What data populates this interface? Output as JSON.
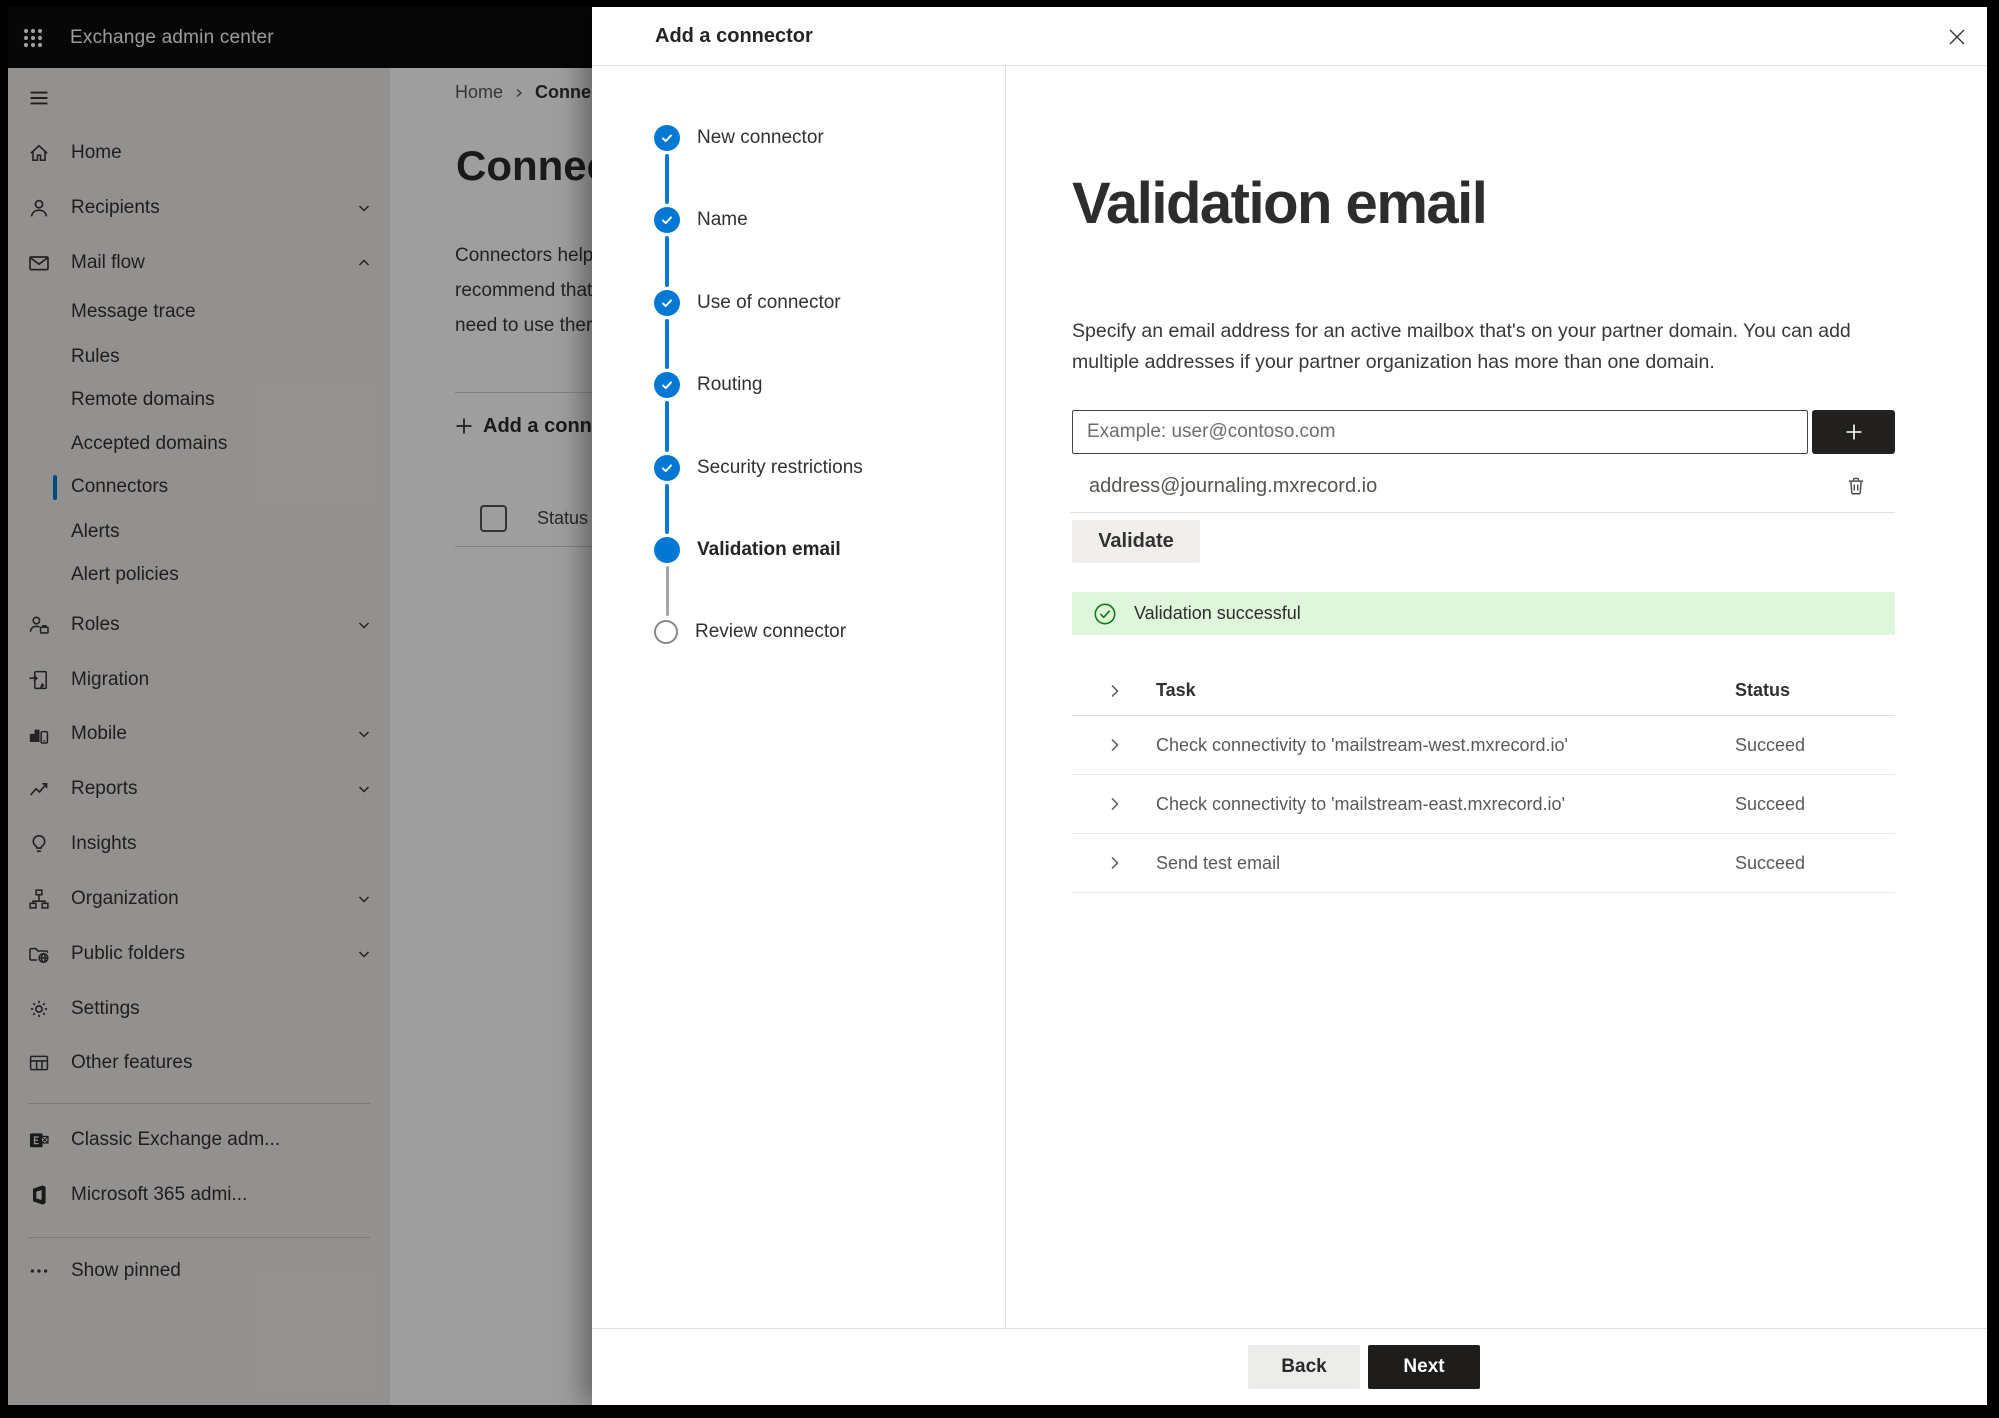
{
  "topbar": {
    "app_title": "Exchange admin center"
  },
  "sidebar": {
    "items": [
      {
        "label": "Home",
        "icon": "home"
      },
      {
        "label": "Recipients",
        "icon": "person",
        "expandable": true
      },
      {
        "label": "Mail flow",
        "icon": "mail",
        "expandable": true,
        "expanded": true,
        "children": [
          "Message trace",
          "Rules",
          "Remote domains",
          "Accepted domains",
          "Connectors",
          "Alerts",
          "Alert policies"
        ],
        "selected_child": "Connectors"
      },
      {
        "label": "Roles",
        "icon": "roles",
        "expandable": true
      },
      {
        "label": "Migration",
        "icon": "migration"
      },
      {
        "label": "Mobile",
        "icon": "mobile",
        "expandable": true
      },
      {
        "label": "Reports",
        "icon": "reports",
        "expandable": true
      },
      {
        "label": "Insights",
        "icon": "insights"
      },
      {
        "label": "Organization",
        "icon": "organization",
        "expandable": true
      },
      {
        "label": "Public folders",
        "icon": "public-folders",
        "expandable": true
      },
      {
        "label": "Settings",
        "icon": "settings"
      },
      {
        "label": "Other features",
        "icon": "other-features"
      }
    ],
    "footer_items": [
      {
        "label": "Classic Exchange adm..."
      },
      {
        "label": "Microsoft 365 admi..."
      },
      {
        "label": "Show pinned"
      }
    ]
  },
  "background_page": {
    "breadcrumb": {
      "home": "Home",
      "current": "Conne"
    },
    "title": "Connec",
    "paragraph_lines": [
      "Connectors help",
      "recommend that",
      "need to use ther"
    ],
    "add_button": "Add a conn",
    "column_header": "Status"
  },
  "dialog": {
    "title": "Add a connector",
    "steps": [
      {
        "label": "New connector",
        "state": "done"
      },
      {
        "label": "Name",
        "state": "done"
      },
      {
        "label": "Use of connector",
        "state": "done"
      },
      {
        "label": "Routing",
        "state": "done"
      },
      {
        "label": "Security restrictions",
        "state": "done"
      },
      {
        "label": "Validation email",
        "state": "current"
      },
      {
        "label": "Review connector",
        "state": "todo"
      }
    ],
    "content": {
      "heading": "Validation email",
      "description": "Specify an email address for an active mailbox that's on your partner domain. You can add multiple addresses if your partner organization has more than one domain.",
      "email_placeholder": "Example: user@contoso.com",
      "added_address": "address@journaling.mxrecord.io",
      "validate_button": "Validate",
      "banner_text": "Validation successful",
      "table": {
        "columns": {
          "task": "Task",
          "status": "Status"
        },
        "rows": [
          {
            "task": "Check connectivity to 'mailstream-west.mxrecord.io'",
            "status": "Succeed"
          },
          {
            "task": "Check connectivity to 'mailstream-east.mxrecord.io'",
            "status": "Succeed"
          },
          {
            "task": "Send test email",
            "status": "Succeed"
          }
        ]
      }
    },
    "footer": {
      "back": "Back",
      "next": "Next"
    }
  },
  "colors": {
    "accent_blue": "#0078d4",
    "success_banner_bg": "#dff6dd",
    "success_green": "#107c10",
    "topbar_bg": "#0c0c0c",
    "primary_button_bg": "#1e1d1c"
  }
}
